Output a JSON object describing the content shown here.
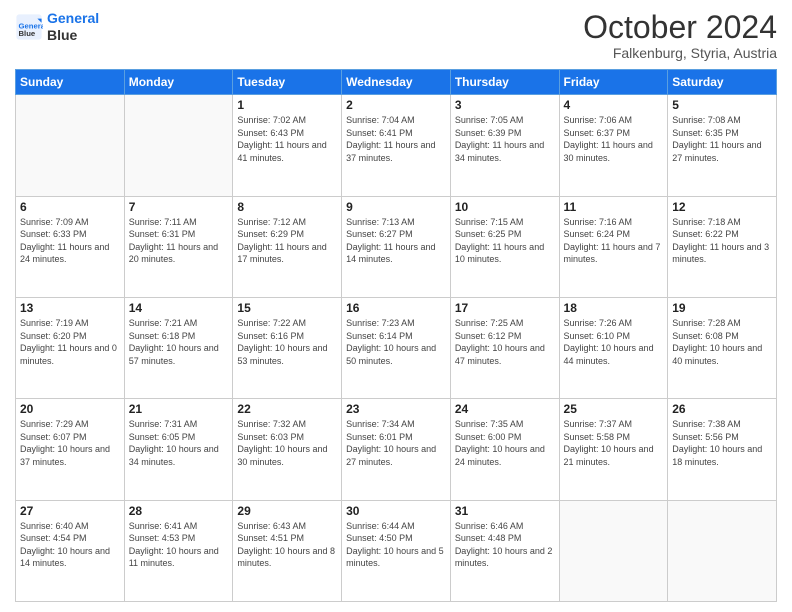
{
  "header": {
    "logo_line1": "General",
    "logo_line2": "Blue",
    "month": "October 2024",
    "location": "Falkenburg, Styria, Austria"
  },
  "weekdays": [
    "Sunday",
    "Monday",
    "Tuesday",
    "Wednesday",
    "Thursday",
    "Friday",
    "Saturday"
  ],
  "weeks": [
    [
      {
        "day": "",
        "sunrise": "",
        "sunset": "",
        "daylight": ""
      },
      {
        "day": "",
        "sunrise": "",
        "sunset": "",
        "daylight": ""
      },
      {
        "day": "1",
        "sunrise": "Sunrise: 7:02 AM",
        "sunset": "Sunset: 6:43 PM",
        "daylight": "Daylight: 11 hours and 41 minutes."
      },
      {
        "day": "2",
        "sunrise": "Sunrise: 7:04 AM",
        "sunset": "Sunset: 6:41 PM",
        "daylight": "Daylight: 11 hours and 37 minutes."
      },
      {
        "day": "3",
        "sunrise": "Sunrise: 7:05 AM",
        "sunset": "Sunset: 6:39 PM",
        "daylight": "Daylight: 11 hours and 34 minutes."
      },
      {
        "day": "4",
        "sunrise": "Sunrise: 7:06 AM",
        "sunset": "Sunset: 6:37 PM",
        "daylight": "Daylight: 11 hours and 30 minutes."
      },
      {
        "day": "5",
        "sunrise": "Sunrise: 7:08 AM",
        "sunset": "Sunset: 6:35 PM",
        "daylight": "Daylight: 11 hours and 27 minutes."
      }
    ],
    [
      {
        "day": "6",
        "sunrise": "Sunrise: 7:09 AM",
        "sunset": "Sunset: 6:33 PM",
        "daylight": "Daylight: 11 hours and 24 minutes."
      },
      {
        "day": "7",
        "sunrise": "Sunrise: 7:11 AM",
        "sunset": "Sunset: 6:31 PM",
        "daylight": "Daylight: 11 hours and 20 minutes."
      },
      {
        "day": "8",
        "sunrise": "Sunrise: 7:12 AM",
        "sunset": "Sunset: 6:29 PM",
        "daylight": "Daylight: 11 hours and 17 minutes."
      },
      {
        "day": "9",
        "sunrise": "Sunrise: 7:13 AM",
        "sunset": "Sunset: 6:27 PM",
        "daylight": "Daylight: 11 hours and 14 minutes."
      },
      {
        "day": "10",
        "sunrise": "Sunrise: 7:15 AM",
        "sunset": "Sunset: 6:25 PM",
        "daylight": "Daylight: 11 hours and 10 minutes."
      },
      {
        "day": "11",
        "sunrise": "Sunrise: 7:16 AM",
        "sunset": "Sunset: 6:24 PM",
        "daylight": "Daylight: 11 hours and 7 minutes."
      },
      {
        "day": "12",
        "sunrise": "Sunrise: 7:18 AM",
        "sunset": "Sunset: 6:22 PM",
        "daylight": "Daylight: 11 hours and 3 minutes."
      }
    ],
    [
      {
        "day": "13",
        "sunrise": "Sunrise: 7:19 AM",
        "sunset": "Sunset: 6:20 PM",
        "daylight": "Daylight: 11 hours and 0 minutes."
      },
      {
        "day": "14",
        "sunrise": "Sunrise: 7:21 AM",
        "sunset": "Sunset: 6:18 PM",
        "daylight": "Daylight: 10 hours and 57 minutes."
      },
      {
        "day": "15",
        "sunrise": "Sunrise: 7:22 AM",
        "sunset": "Sunset: 6:16 PM",
        "daylight": "Daylight: 10 hours and 53 minutes."
      },
      {
        "day": "16",
        "sunrise": "Sunrise: 7:23 AM",
        "sunset": "Sunset: 6:14 PM",
        "daylight": "Daylight: 10 hours and 50 minutes."
      },
      {
        "day": "17",
        "sunrise": "Sunrise: 7:25 AM",
        "sunset": "Sunset: 6:12 PM",
        "daylight": "Daylight: 10 hours and 47 minutes."
      },
      {
        "day": "18",
        "sunrise": "Sunrise: 7:26 AM",
        "sunset": "Sunset: 6:10 PM",
        "daylight": "Daylight: 10 hours and 44 minutes."
      },
      {
        "day": "19",
        "sunrise": "Sunrise: 7:28 AM",
        "sunset": "Sunset: 6:08 PM",
        "daylight": "Daylight: 10 hours and 40 minutes."
      }
    ],
    [
      {
        "day": "20",
        "sunrise": "Sunrise: 7:29 AM",
        "sunset": "Sunset: 6:07 PM",
        "daylight": "Daylight: 10 hours and 37 minutes."
      },
      {
        "day": "21",
        "sunrise": "Sunrise: 7:31 AM",
        "sunset": "Sunset: 6:05 PM",
        "daylight": "Daylight: 10 hours and 34 minutes."
      },
      {
        "day": "22",
        "sunrise": "Sunrise: 7:32 AM",
        "sunset": "Sunset: 6:03 PM",
        "daylight": "Daylight: 10 hours and 30 minutes."
      },
      {
        "day": "23",
        "sunrise": "Sunrise: 7:34 AM",
        "sunset": "Sunset: 6:01 PM",
        "daylight": "Daylight: 10 hours and 27 minutes."
      },
      {
        "day": "24",
        "sunrise": "Sunrise: 7:35 AM",
        "sunset": "Sunset: 6:00 PM",
        "daylight": "Daylight: 10 hours and 24 minutes."
      },
      {
        "day": "25",
        "sunrise": "Sunrise: 7:37 AM",
        "sunset": "Sunset: 5:58 PM",
        "daylight": "Daylight: 10 hours and 21 minutes."
      },
      {
        "day": "26",
        "sunrise": "Sunrise: 7:38 AM",
        "sunset": "Sunset: 5:56 PM",
        "daylight": "Daylight: 10 hours and 18 minutes."
      }
    ],
    [
      {
        "day": "27",
        "sunrise": "Sunrise: 6:40 AM",
        "sunset": "Sunset: 4:54 PM",
        "daylight": "Daylight: 10 hours and 14 minutes."
      },
      {
        "day": "28",
        "sunrise": "Sunrise: 6:41 AM",
        "sunset": "Sunset: 4:53 PM",
        "daylight": "Daylight: 10 hours and 11 minutes."
      },
      {
        "day": "29",
        "sunrise": "Sunrise: 6:43 AM",
        "sunset": "Sunset: 4:51 PM",
        "daylight": "Daylight: 10 hours and 8 minutes."
      },
      {
        "day": "30",
        "sunrise": "Sunrise: 6:44 AM",
        "sunset": "Sunset: 4:50 PM",
        "daylight": "Daylight: 10 hours and 5 minutes."
      },
      {
        "day": "31",
        "sunrise": "Sunrise: 6:46 AM",
        "sunset": "Sunset: 4:48 PM",
        "daylight": "Daylight: 10 hours and 2 minutes."
      },
      {
        "day": "",
        "sunrise": "",
        "sunset": "",
        "daylight": ""
      },
      {
        "day": "",
        "sunrise": "",
        "sunset": "",
        "daylight": ""
      }
    ]
  ]
}
